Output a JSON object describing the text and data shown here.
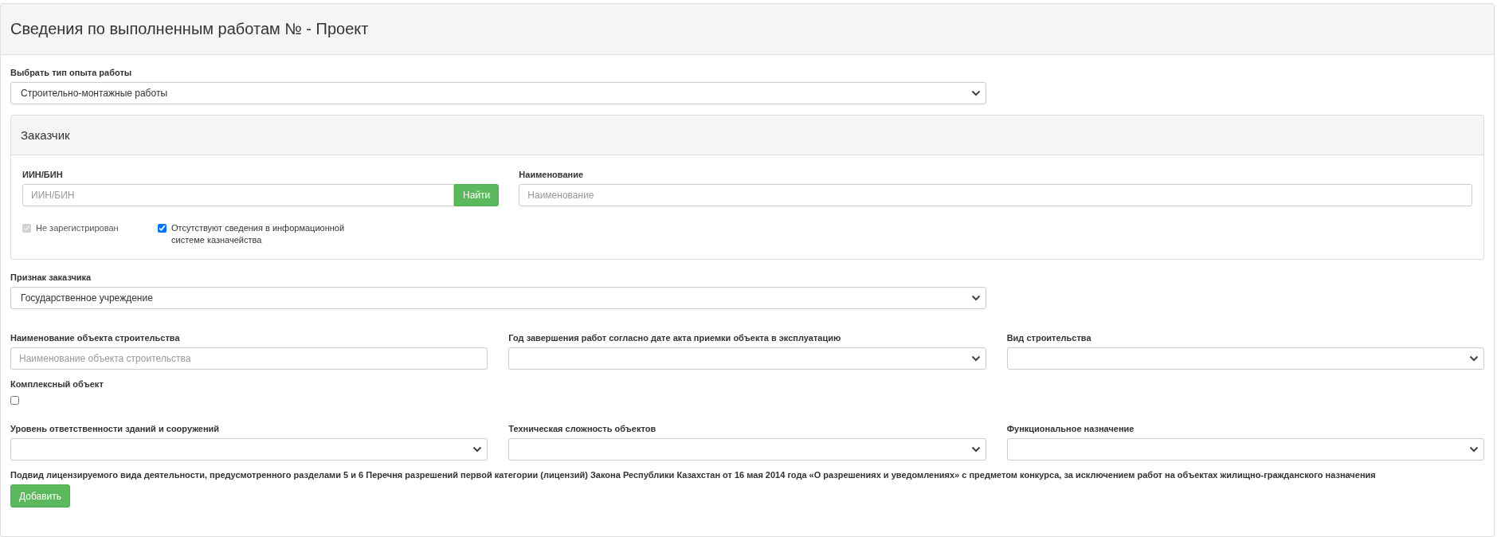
{
  "title": "Сведения по выполненным работам № - Проект",
  "experience_type": {
    "label": "Выбрать тип опыта работы",
    "value": "Строительно-монтажные работы"
  },
  "customer": {
    "title": "Заказчик",
    "iin": {
      "label": "ИИН/БИН",
      "placeholder": "ИИН/БИН",
      "button": "Найти"
    },
    "name": {
      "label": "Наименование",
      "placeholder": "Наименование"
    },
    "checkboxes": [
      {
        "label": "Не зарегистрирован",
        "checked": true,
        "disabled": true
      },
      {
        "label": "Отсутствуют сведения в информационной системе казначейства",
        "checked": true,
        "disabled": false
      }
    ]
  },
  "customer_sign": {
    "label": "Признак заказчика",
    "value": "Государственное учреждение"
  },
  "row1": [
    {
      "kind": "input",
      "label": "Наименование объекта строительства",
      "placeholder": "Наименование объекта строительства"
    },
    {
      "kind": "select",
      "label": "Год завершения работ согласно дате акта приемки объекта в эксплуатацию"
    },
    {
      "kind": "select",
      "label": "Вид строительства"
    }
  ],
  "complex_object": {
    "label": "Комплексный объект",
    "checked": false
  },
  "row2": [
    {
      "kind": "select",
      "label": "Уровень ответственности зданий и сооружений"
    },
    {
      "kind": "select",
      "label": "Техническая сложность объектов"
    },
    {
      "kind": "select",
      "label": "Функциональное назначение"
    }
  ],
  "subtype": {
    "label": "Подвид лицензируемого вида деятельности, предусмотренного разделами 5 и 6 Перечня разрешений первой категории (лицензий) Закона Республики Казахстан от 16 мая 2014 года «О разрешениях и уведомлениях» с предметом конкурса, за исключением работ на объектах жилищно-гражданского назначения",
    "button": "Добавить"
  }
}
